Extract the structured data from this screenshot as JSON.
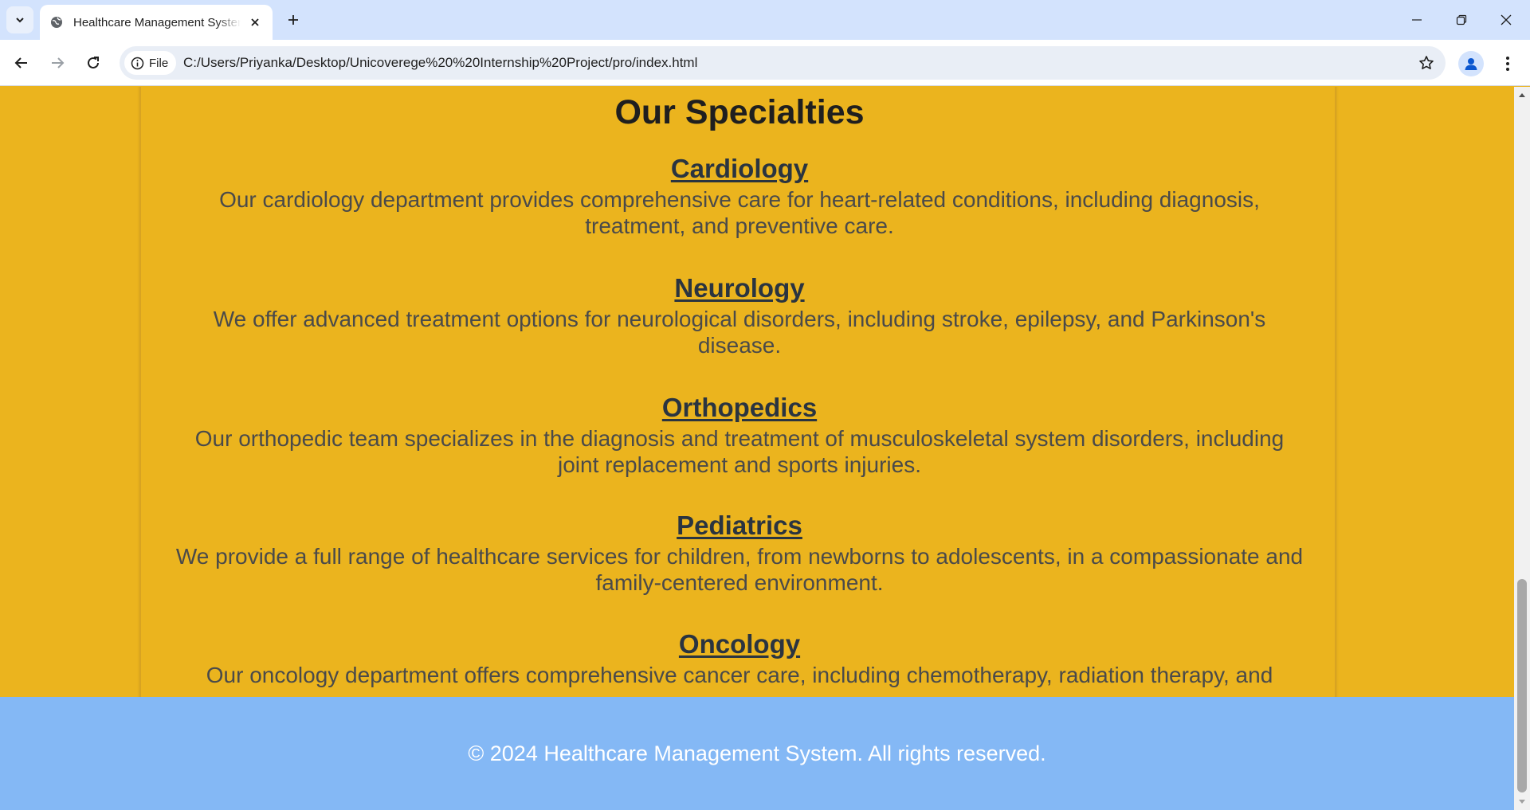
{
  "browser": {
    "tab_title": "Healthcare Management System",
    "url_scheme_label": "File",
    "url": "C:/Users/Priyanka/Desktop/Unicoverege%20%20Internship%20Project/pro/index.html"
  },
  "page": {
    "section_title": "Our Specialties",
    "specialties": [
      {
        "name": "Cardiology",
        "description": "Our cardiology department provides comprehensive care for heart-related conditions, including diagnosis, treatment, and preventive care."
      },
      {
        "name": "Neurology",
        "description": "We offer advanced treatment options for neurological disorders, including stroke, epilepsy, and Parkinson's disease."
      },
      {
        "name": "Orthopedics",
        "description": "Our orthopedic team specializes in the diagnosis and treatment of musculoskeletal system disorders, including joint replacement and sports injuries."
      },
      {
        "name": "Pediatrics",
        "description": "We provide a full range of healthcare services for children, from newborns to adolescents, in a compassionate and family-centered environment."
      },
      {
        "name": "Oncology",
        "description": "Our oncology department offers comprehensive cancer care, including chemotherapy, radiation therapy, and"
      }
    ],
    "footer_text": "© 2024 Healthcare Management System. All rights reserved."
  },
  "colors": {
    "page_bg": "#ebb41e",
    "footer_bg": "#84b8f5",
    "tabbar_bg": "#d3e3fd"
  }
}
